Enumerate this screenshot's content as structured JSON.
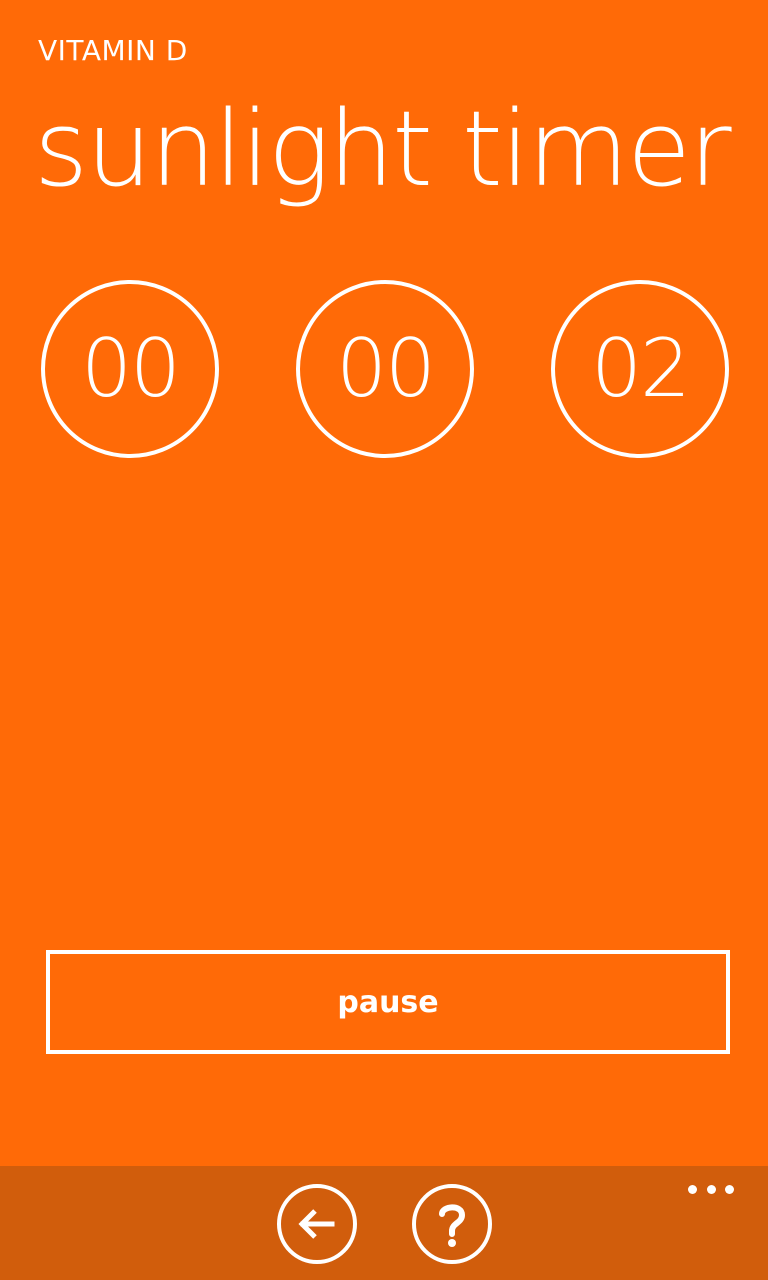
{
  "app": {
    "name": "VITAMIN D",
    "page_title": "sunlight timer"
  },
  "timer": {
    "hours": "00",
    "minutes": "00",
    "seconds": "02"
  },
  "controls": {
    "pause_label": "pause"
  },
  "app_bar": {
    "buttons": [
      {
        "icon": "back-arrow-icon"
      },
      {
        "icon": "help-question-icon"
      }
    ],
    "more_icon": "ellipsis-icon"
  },
  "colors": {
    "accent_background": "#FF6A07",
    "app_bar_background": "#D15D0C",
    "foreground": "#FFFFFF"
  }
}
